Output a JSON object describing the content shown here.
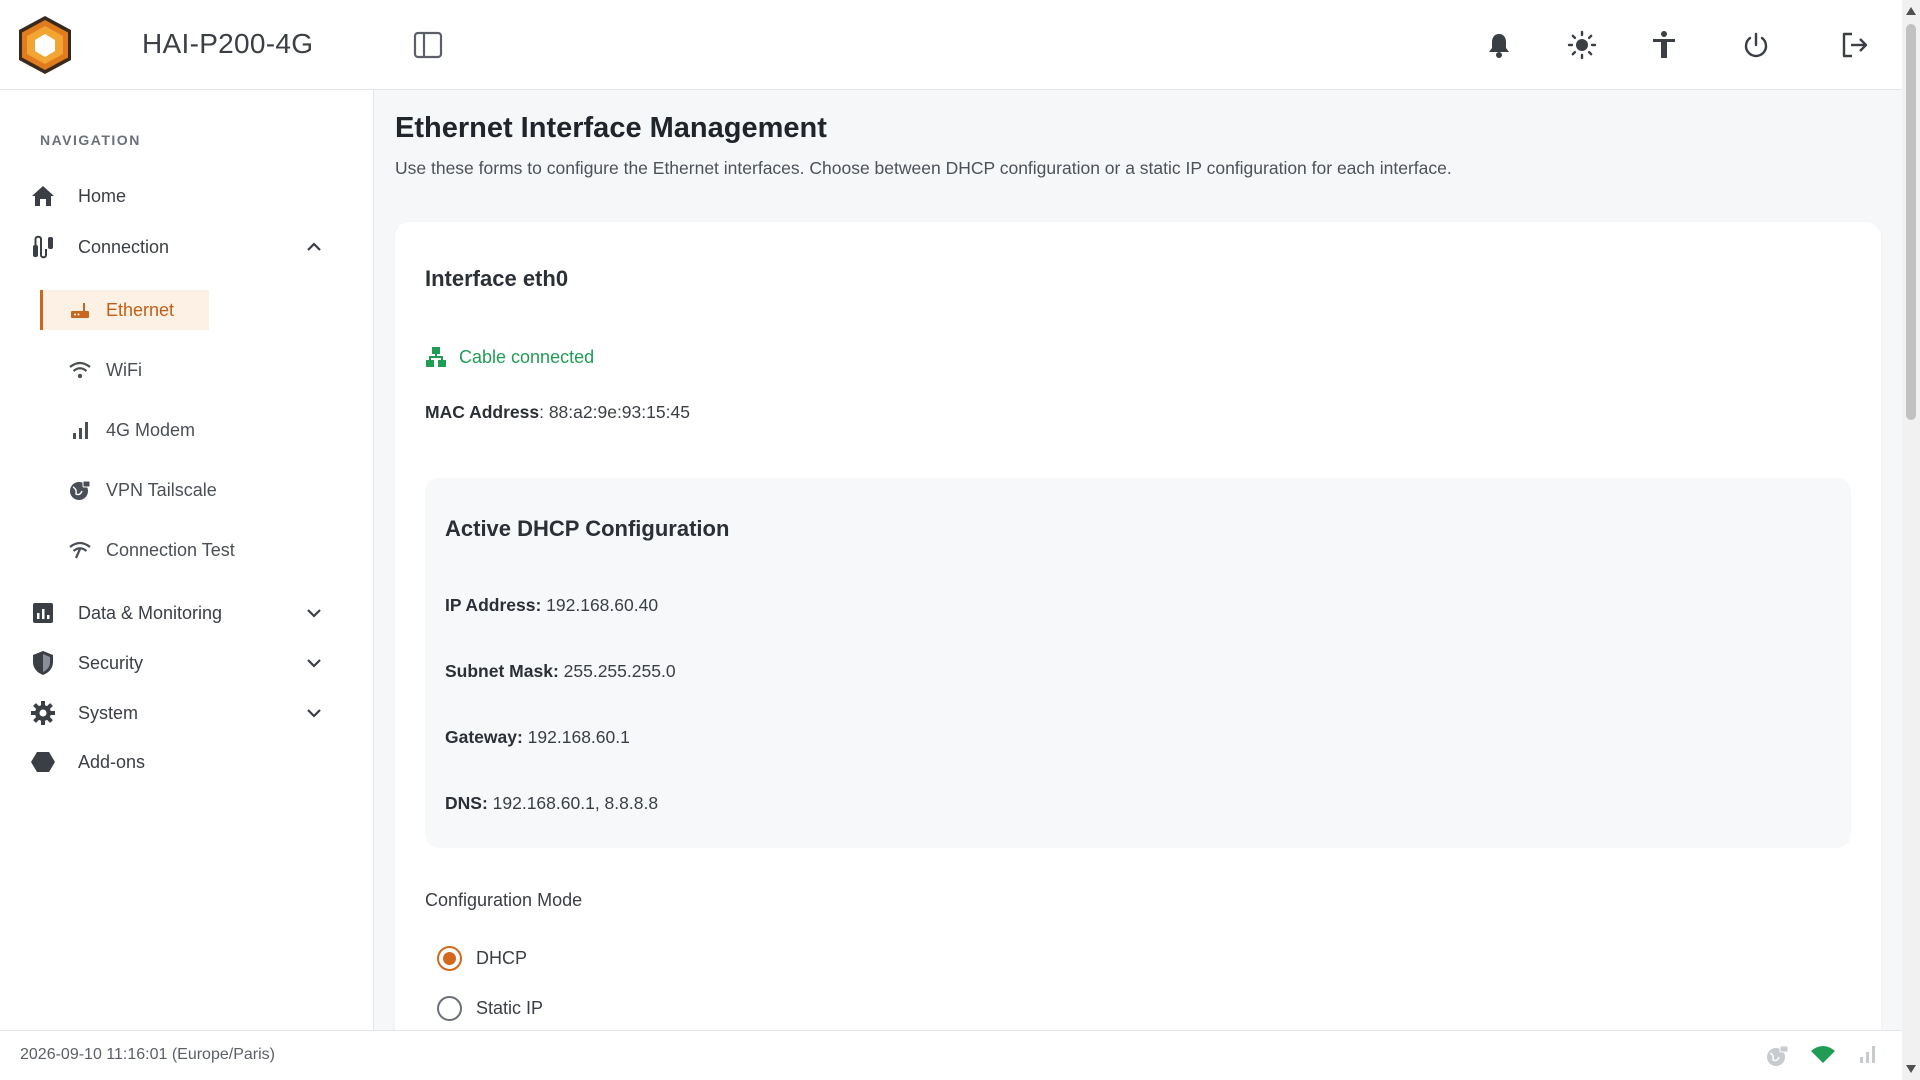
{
  "app": {
    "title": "HAI-P200-4G"
  },
  "topbar": {
    "icons": [
      "sidebar-toggle-icon",
      "bell-icon",
      "sun-icon",
      "accessibility-icon",
      "power-icon",
      "logout-icon"
    ]
  },
  "sidebar": {
    "heading": "NAVIGATION",
    "items": [
      {
        "label": "Home",
        "icon": "home-icon"
      },
      {
        "label": "Connection",
        "icon": "connection-icon",
        "expanded": true
      },
      {
        "label": "Data & Monitoring",
        "icon": "chart-icon",
        "expanded": false
      },
      {
        "label": "Security",
        "icon": "shield-icon",
        "expanded": false
      },
      {
        "label": "System",
        "icon": "gear-icon",
        "expanded": false
      },
      {
        "label": "Add-ons",
        "icon": "hexagon-icon"
      }
    ],
    "connection_sub": [
      {
        "label": "Ethernet",
        "icon": "router-icon",
        "active": true
      },
      {
        "label": "WiFi",
        "icon": "wifi-icon"
      },
      {
        "label": "4G Modem",
        "icon": "signal-bars-icon"
      },
      {
        "label": "VPN Tailscale",
        "icon": "vpn-globe-icon"
      },
      {
        "label": "Connection Test",
        "icon": "wifi-test-icon"
      }
    ]
  },
  "main": {
    "title": "Ethernet Interface Management",
    "description": "Use these forms to configure the Ethernet interfaces. Choose between DHCP configuration or a static IP configuration for each interface.",
    "interface": {
      "title": "Interface eth0",
      "cable_status": "Cable connected",
      "mac_label": "MAC Address",
      "mac_value": ": 88:a2:9e:93:15:45"
    },
    "dhcp": {
      "title": "Active DHCP Configuration",
      "ip_label": "IP Address:",
      "ip_value": " 192.168.60.40",
      "mask_label": "Subnet Mask:",
      "mask_value": " 255.255.255.0",
      "gateway_label": "Gateway:",
      "gateway_value": " 192.168.60.1",
      "dns_label": "DNS:",
      "dns_value": " 192.168.60.1, 8.8.8.8"
    },
    "config_mode": {
      "label": "Configuration Mode",
      "options": [
        {
          "label": "DHCP",
          "selected": true
        },
        {
          "label": "Static IP",
          "selected": false
        }
      ]
    }
  },
  "footer": {
    "datetime": "2026-09-10 11:16:01 (Europe/Paris)",
    "status_icons": [
      "vpn-status-icon",
      "wifi-status-icon",
      "cellular-status-icon"
    ]
  },
  "colors": {
    "accent": "#c9671d",
    "success": "#1f9d55"
  }
}
